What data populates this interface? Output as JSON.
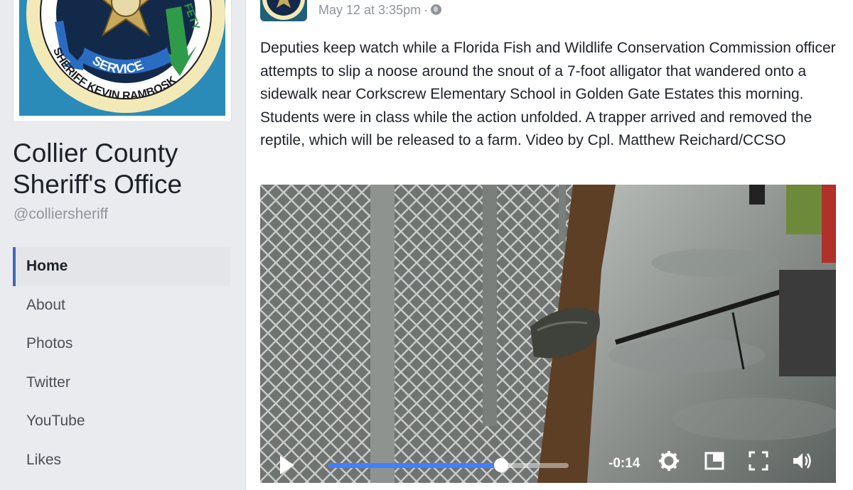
{
  "profile": {
    "badge_text_service": "SERVICE",
    "badge_text_safety": "FETY",
    "badge_text_sheriff": "SHERIFF KEVIN RAMBOSK",
    "page_name": "Collier County Sheriff's Office",
    "handle": "@colliersheriff"
  },
  "nav": {
    "items": [
      {
        "label": "Home"
      },
      {
        "label": "About"
      },
      {
        "label": "Photos"
      },
      {
        "label": "Twitter"
      },
      {
        "label": "YouTube"
      },
      {
        "label": "Likes"
      }
    ]
  },
  "post": {
    "timestamp": "May 12 at 3:35pm",
    "separator": "·",
    "audience_icon": "globe-icon",
    "text": "Deputies keep watch while a Florida Fish and Wildlife Conservation Commission officer attempts to slip a noose around the snout of a 7-foot alligator that wandered onto a sidewalk near Corkscrew Elementary School in Golden Gate Estates this morning. Students were in class while the action unfolded. A trapper arrived and removed the reptile, which will be released to a farm. Video by Cpl. Matthew Reichard/CCSO"
  },
  "video": {
    "time_remaining": "-0:14",
    "progress_fraction": 0.72,
    "icons": [
      "play-icon",
      "settings-gear-icon",
      "picture-in-picture-icon",
      "fullscreen-icon",
      "volume-icon"
    ]
  },
  "colors": {
    "accent": "#4267b2",
    "progress": "#4080ff",
    "background": "#e9ebee"
  }
}
